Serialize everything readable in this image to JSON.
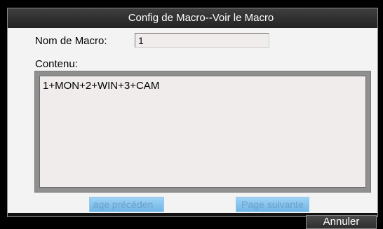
{
  "dialog": {
    "title": "Config de Macro--Voir le Macro"
  },
  "form": {
    "name_label": "Nom de Macro:",
    "name_value": "1",
    "content_label": "Contenu:",
    "content_value": "1+MON+2+WIN+3+CAM"
  },
  "buttons": {
    "previous_label": "age précéden",
    "next_label": "Page suivante",
    "cancel_label": "Annuler"
  }
}
